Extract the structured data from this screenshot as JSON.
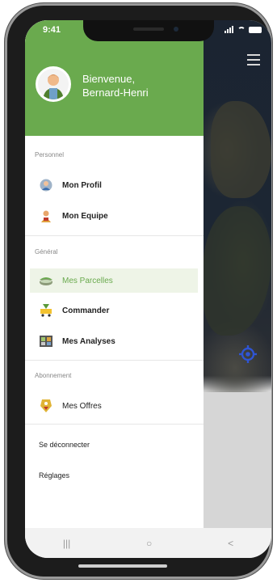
{
  "status": {
    "time": "9:41"
  },
  "header": {
    "greeting": "Bienvenue,",
    "user_name": "Bernard-Henri"
  },
  "sections": {
    "personal": {
      "title": "Personnel",
      "items": [
        {
          "label": "Mon Profil",
          "icon": "user-icon"
        },
        {
          "label": "Mon Equipe",
          "icon": "team-icon"
        }
      ]
    },
    "general": {
      "title": "Général",
      "items": [
        {
          "label": "Mes Parcelles",
          "icon": "field-icon",
          "active": true
        },
        {
          "label": "Commander",
          "icon": "cart-icon"
        },
        {
          "label": "Mes Analyses",
          "icon": "analysis-icon"
        }
      ]
    },
    "subscription": {
      "title": "Abonnement",
      "items": [
        {
          "label": "Mes Offres",
          "icon": "offer-tag-icon"
        }
      ]
    }
  },
  "footer_links": {
    "logout": "Se déconnecter",
    "settings": "Réglages"
  },
  "navbar": {
    "recents": "|||",
    "home": "○",
    "back": "<"
  },
  "colors": {
    "accent": "#6aaa4e",
    "active_bg": "#eef4e7",
    "locate": "#2f55d4"
  }
}
